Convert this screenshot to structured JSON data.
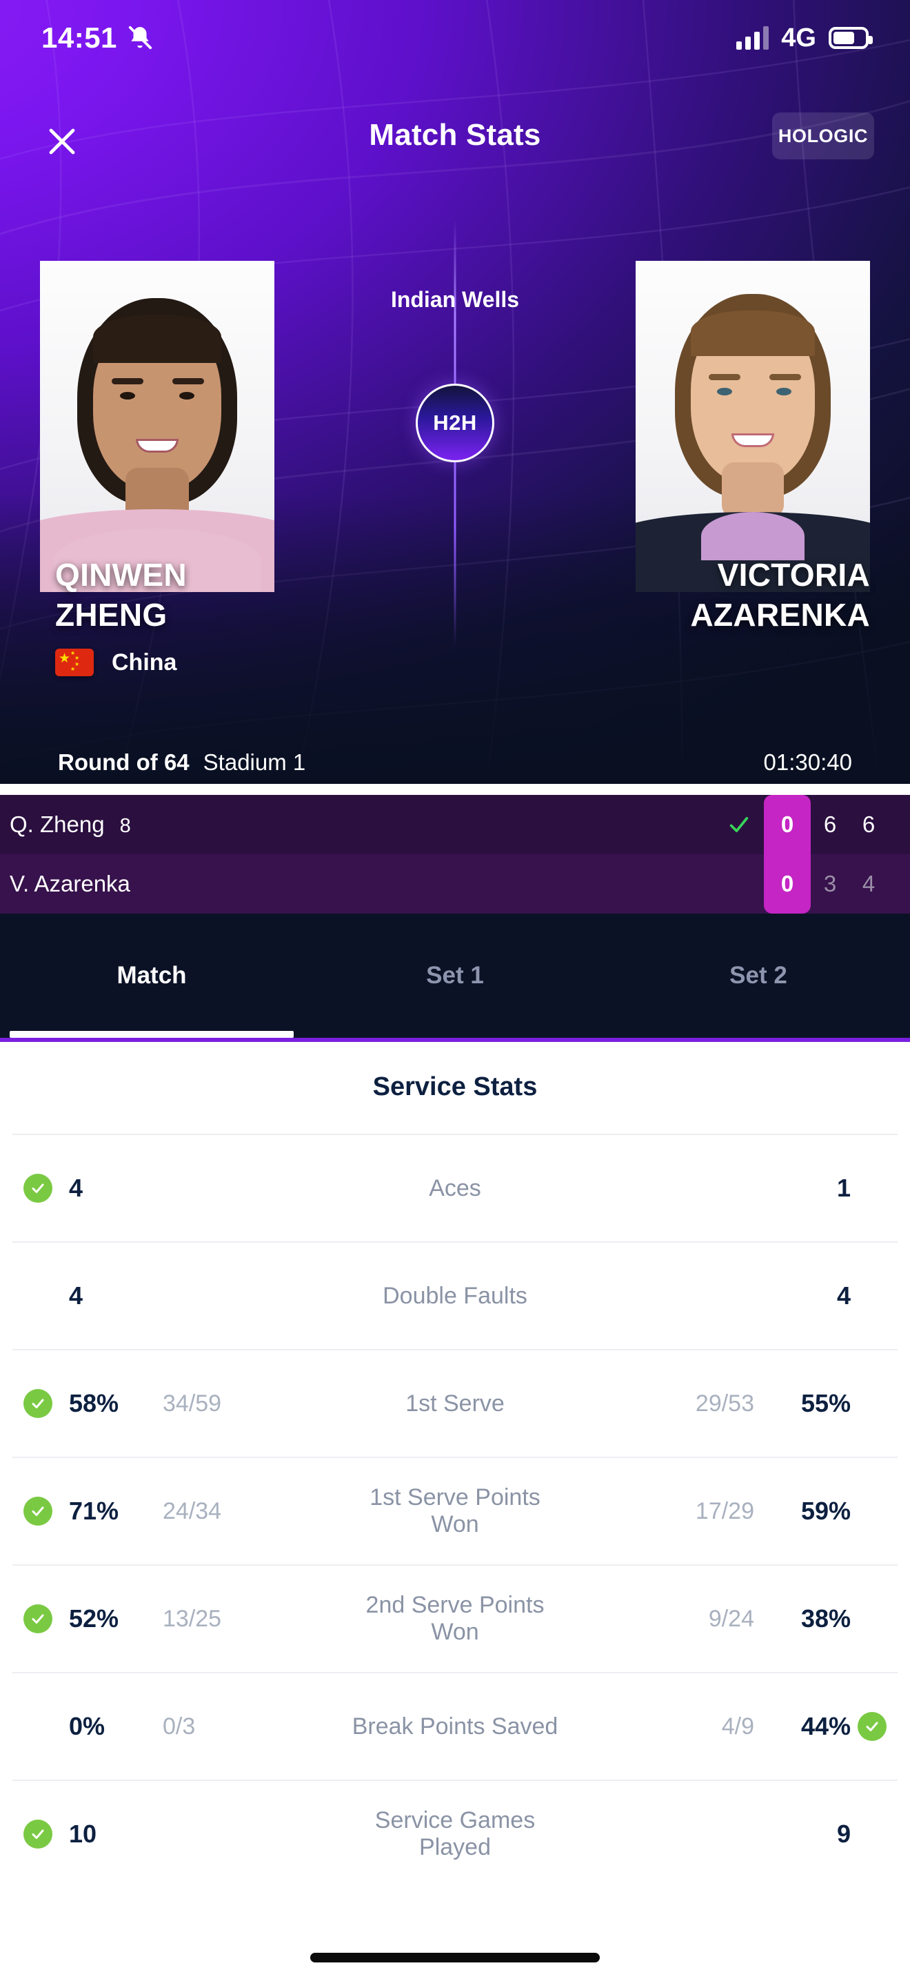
{
  "status_bar": {
    "time": "14:51",
    "mute_icon": "bell-muted-icon",
    "signal_icon": "signal-bars-icon",
    "network": "4G",
    "battery_icon": "battery-icon"
  },
  "header": {
    "close_icon": "close-icon",
    "title": "Match Stats",
    "sponsor": "HOLOGIC"
  },
  "match_header": {
    "tournament": "Indian Wells",
    "h2h_label": "H2H",
    "player_left": {
      "first_name": "QINWEN",
      "last_name": "ZHENG",
      "country": "China",
      "flag_icon": "china-flag-icon"
    },
    "player_right": {
      "first_name": "VICTORIA",
      "last_name": "AZARENKA"
    }
  },
  "meta": {
    "round": "Round of 64",
    "court": "Stadium 1",
    "duration": "01:30:40"
  },
  "scoreboard": {
    "rows": [
      {
        "name": "Q. Zheng",
        "seed": "8",
        "winner_check": true,
        "current_game": "0",
        "sets": [
          "6",
          "6"
        ]
      },
      {
        "name": "V. Azarenka",
        "seed": "",
        "winner_check": false,
        "current_game": "0",
        "sets": [
          "3",
          "4"
        ]
      }
    ]
  },
  "tabs": [
    {
      "label": "Match",
      "active": true
    },
    {
      "label": "Set 1",
      "active": false
    },
    {
      "label": "Set 2",
      "active": false
    }
  ],
  "stats": {
    "section_title": "Service Stats",
    "rows": [
      {
        "label": "Aces",
        "left_value": "4",
        "left_sub": "",
        "left_win": true,
        "right_value": "1",
        "right_sub": "",
        "right_win": false
      },
      {
        "label": "Double Faults",
        "left_value": "4",
        "left_sub": "",
        "left_win": false,
        "right_value": "4",
        "right_sub": "",
        "right_win": false
      },
      {
        "label": "1st Serve",
        "left_value": "58%",
        "left_sub": "34/59",
        "left_win": true,
        "right_value": "55%",
        "right_sub": "29/53",
        "right_win": false
      },
      {
        "label": "1st Serve Points Won",
        "left_value": "71%",
        "left_sub": "24/34",
        "left_win": true,
        "right_value": "59%",
        "right_sub": "17/29",
        "right_win": false
      },
      {
        "label": "2nd Serve Points Won",
        "left_value": "52%",
        "left_sub": "13/25",
        "left_win": true,
        "right_value": "38%",
        "right_sub": "9/24",
        "right_win": false
      },
      {
        "label": "Break Points Saved",
        "left_value": "0%",
        "left_sub": "0/3",
        "left_win": false,
        "right_value": "44%",
        "right_sub": "4/9",
        "right_win": true
      },
      {
        "label": "Service Games Played",
        "left_value": "10",
        "left_sub": "",
        "left_win": true,
        "right_value": "9",
        "right_sub": "",
        "right_win": false
      }
    ]
  },
  "colors": {
    "accent_purple": "#7b16ef",
    "score_magenta": "#c425c4",
    "win_green": "#7ac943",
    "dark_navy": "#0b1226",
    "text_dark": "#0d2040",
    "text_muted": "#8a93a5"
  }
}
